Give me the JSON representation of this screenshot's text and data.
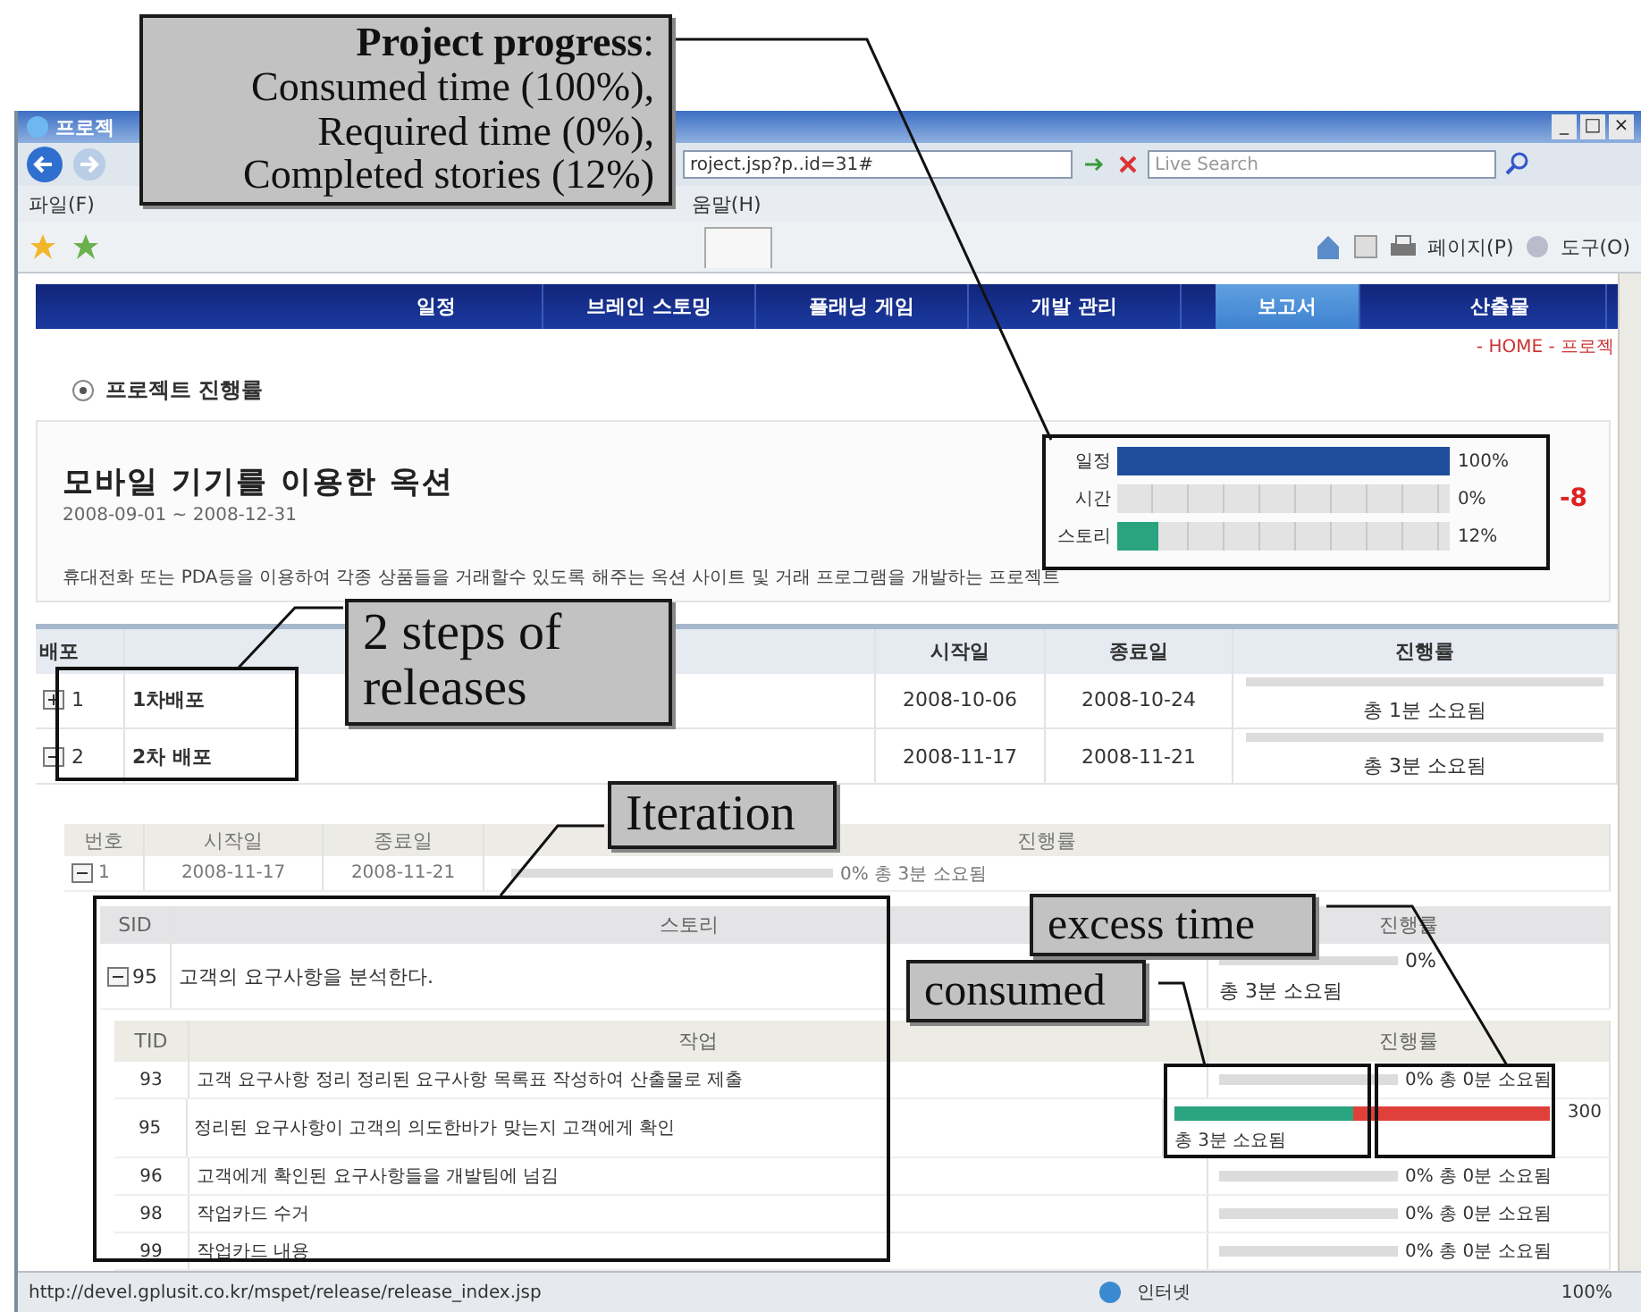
{
  "window": {
    "title": "프로젝",
    "controls": [
      "_",
      "□",
      "×"
    ]
  },
  "address_bar": {
    "value": "roject.jsp?p..id=31#",
    "search_placeholder": "Live Search"
  },
  "menu": [
    "파일(F)",
    "움말(H)"
  ],
  "toolbar": [
    "페이지(P)",
    "도구(O)"
  ],
  "nav": [
    {
      "label": "일정",
      "selected": false
    },
    {
      "label": "브레인 스토밍",
      "selected": false
    },
    {
      "label": "플래닝 게임",
      "selected": false
    },
    {
      "label": "개발 관리",
      "selected": false
    },
    {
      "label": "보고서",
      "selected": true
    },
    {
      "label": "산출물",
      "selected": false
    }
  ],
  "breadcrumb": "- HOME - 프로젝",
  "section_title": "프로젝트 진행률",
  "project": {
    "title": "모바일 기기를 이용한 옥션",
    "dates": "2008-09-01 ~ 2008-12-31",
    "description": "휴대전화 또는 PDA등을 이용하여 각종 상품들을 거래할수 있도록 해주는 옥션 사이트 및 거래 프로그램을 개발하는 프로젝트",
    "overdue": "-8",
    "meters": [
      {
        "label": "일정",
        "level": 1,
        "reading": "100%",
        "color": "#1f4f9c"
      },
      {
        "label": "시간",
        "reading": "0%"
      },
      {
        "label": "스토리",
        "level": 0.12,
        "reading": "12%",
        "color": "#2aa37f"
      }
    ]
  },
  "releases": {
    "columns": [
      "배포",
      "시작일",
      "종료일",
      "진행률"
    ],
    "rows": [
      {
        "number": "1",
        "name": "1차배포",
        "start": "2008-10-06",
        "end": "2008-10-24",
        "progress": "총 1분 소요됨",
        "expanded": false
      },
      {
        "number": "2",
        "name": "2차 배포",
        "start": "2008-11-17",
        "end": "2008-11-21",
        "progress": "총 3분 소요됨",
        "expanded": true
      }
    ]
  },
  "iterations": {
    "columns": [
      "번호",
      "시작일",
      "종료일",
      "진행률"
    ],
    "rows": [
      {
        "number": "1",
        "start": "2008-11-17",
        "end": "2008-11-21",
        "progress": "0% 총 3분 소요됨",
        "expanded": true
      }
    ]
  },
  "stories": {
    "columns": [
      "SID",
      "스토리",
      "진행률"
    ],
    "rows": [
      {
        "id": "95",
        "title": "고객의 요구사항을 분석한다.",
        "percent": "0%",
        "progress": "총 3분 소요됨",
        "expanded": true
      }
    ]
  },
  "tasks": {
    "columns": [
      "TID",
      "작업",
      "진행률"
    ],
    "rows": [
      {
        "id": "93",
        "title": "고객 요구사항 정리 정리된 요구사항 목록표 작성하여 산출물로 제출",
        "kind": "normal",
        "progress": "0% 총 0분 소요됨"
      },
      {
        "id": "95",
        "title": "정리된 요구사항이 고객의 의도한바가 맞는지 고객에게 확인",
        "kind": "overrun",
        "level": 1,
        "excess": {
          "level": 1
        },
        "progress": "총 3분 소요됨",
        "over_reading": "300"
      },
      {
        "id": "96",
        "title": "고객에게 확인된 요구사항들을 개발팀에 넘김",
        "kind": "normal",
        "progress": "0% 총 0분 소요됨"
      },
      {
        "id": "98",
        "title": "작업카드 수거",
        "kind": "normal",
        "progress": "0% 총 0분 소요됨"
      },
      {
        "id": "99",
        "title": "작업카드 내용",
        "kind": "normal",
        "progress": "0% 총 0분 소요됨"
      }
    ]
  },
  "status_bar": {
    "url": "http://devel.gplusit.co.kr/mspet/release/release_index.jsp",
    "zone": "인터넷",
    "zoom": "100%"
  },
  "callouts": [
    {
      "lines": [
        "**Project progress**:",
        "Consumed time (100%),",
        "Required time (0%),",
        "Completed stories (12%)"
      ]
    },
    {
      "lines": [
        "2 steps of",
        "releases"
      ]
    },
    {
      "lines": [
        "Iteration"
      ]
    },
    {
      "lines": [
        "excess time"
      ]
    },
    {
      "lines": [
        "consumed"
      ]
    }
  ]
}
